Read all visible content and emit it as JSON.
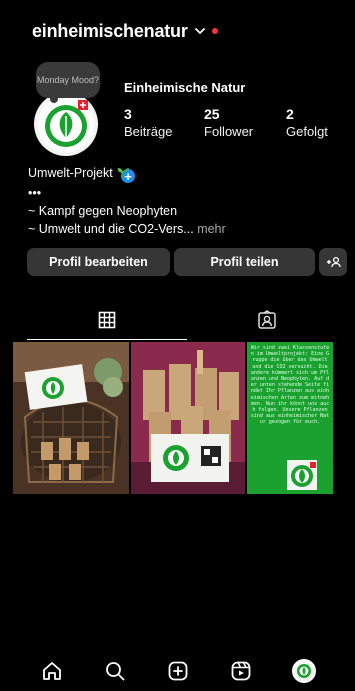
{
  "header": {
    "username": "einheimischenatur",
    "notification_dot_color": "#ff3040"
  },
  "profile": {
    "note": "Monday Mood?",
    "display_name": "Einheimische Natur",
    "stats": [
      {
        "value": "3",
        "label": "Beiträge"
      },
      {
        "value": "25",
        "label": "Follower"
      },
      {
        "value": "2",
        "label": "Gefolgt"
      }
    ],
    "bio": {
      "line1": "Umwelt-Projekt",
      "line2": "•••",
      "line3": "~ Kampf gegen Neophyten",
      "line4": "~ Umwelt und die CO2-Vers...",
      "more": "mehr"
    }
  },
  "actions": {
    "edit_profile": "Profil bearbeiten",
    "share_profile": "Profil teilen",
    "add_user_icon": "+👤"
  },
  "tabs": [
    {
      "icon": "grid-icon",
      "active": true
    },
    {
      "icon": "tagged-icon",
      "active": false
    }
  ],
  "posts": [
    {
      "description_color": "#5a4030"
    },
    {
      "description_color": "#7a2346"
    },
    {
      "text": "Wir sind zwei Klassenstufen im Umweltprojekt: Eine Gruppe die über das Umwelt und die CO2 versucht. Die andere kümmert sich um Pflanzen und Neophyten. Auf der unten stehende Seite findet Ihr Pflanzen aus einheimischen Arten zum mitnehmen. Nun ihr könnt uns auch folgen. Unsere Pflanzen sind aus einheimischer Natur gezogen für euch."
    }
  ],
  "nav": [
    "home-icon",
    "search-icon",
    "create-icon",
    "reels-icon",
    "profile-avatar"
  ],
  "colors": {
    "accent_blue": "#1f8ef1",
    "brand_green": "#1aa130",
    "button_bg": "#363636"
  }
}
